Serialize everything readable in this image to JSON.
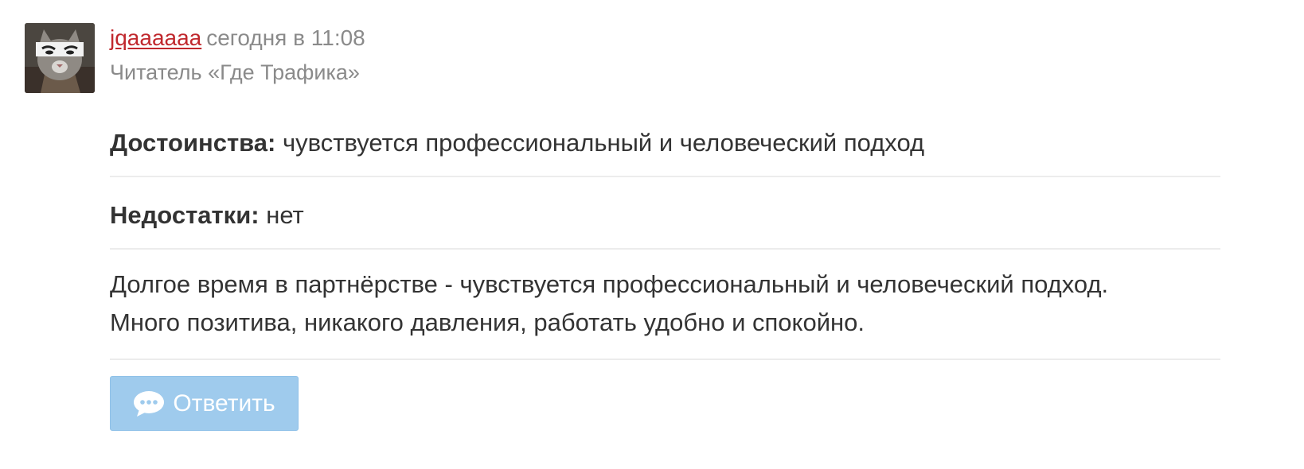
{
  "review": {
    "author": {
      "username": "jqaaaaaa",
      "date": "сегодня в 11:08",
      "role": "Читатель «Где Трафика»",
      "avatar_icon": "cat-avatar"
    },
    "pros": {
      "label": "Достоинства:",
      "text": "чувствуется профессиональный и человеческий подход"
    },
    "cons": {
      "label": "Недостатки:",
      "text": "нет"
    },
    "comment": {
      "line1": "Долгое время в партнёрстве - чувствуется профессиональный и человеческий подход.",
      "line2": "Много позитива, никакого давления, работать удобно и спокойно."
    },
    "reply_button": {
      "label": "Ответить",
      "icon": "speech-bubble-icon"
    }
  },
  "colors": {
    "username": "#c0282d",
    "muted": "#8a8a8a",
    "text": "#333333",
    "reply_button_bg": "#9fcbed",
    "divider": "#ececec"
  }
}
